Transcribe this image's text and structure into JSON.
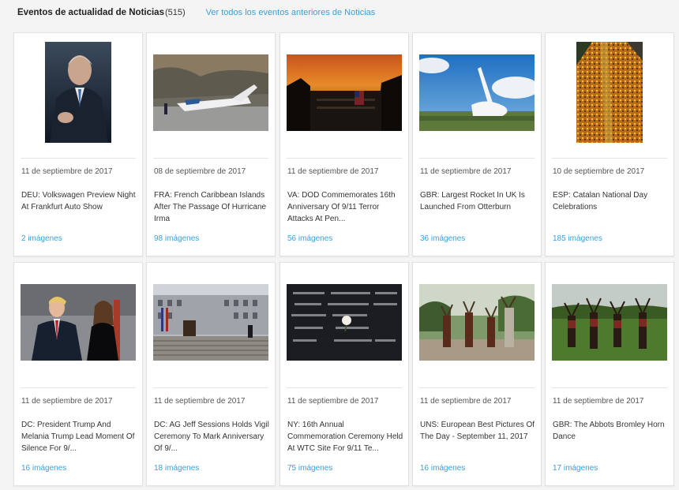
{
  "header": {
    "title": "Eventos de actualidad de Noticias",
    "count": "(515)",
    "link_label": "Ver todos los eventos anteriores de Noticias"
  },
  "colors": {
    "accent": "#3aa0d8",
    "card_bg": "#ffffff",
    "page_bg": "#f4f4f4"
  },
  "cards": [
    {
      "date": "11 de septiembre de 2017",
      "title": "DEU: Volkswagen Preview Night At Frankfurt Auto Show",
      "images": "2 imágenes"
    },
    {
      "date": "08 de septiembre de 2017",
      "title": "FRA: French Caribbean Islands After The Passage Of Hurricane Irma",
      "images": "98 imágenes"
    },
    {
      "date": "11 de septiembre de 2017",
      "title": "VA: DOD Commemorates 16th Anniversary Of 9/11 Terror Attacks At Pen...",
      "images": "56 imágenes"
    },
    {
      "date": "11 de septiembre de 2017",
      "title": "GBR: Largest Rocket In UK Is Launched From Otterburn",
      "images": "36 imágenes"
    },
    {
      "date": "10 de septiembre de 2017",
      "title": "ESP: Catalan National Day Celebrations",
      "images": "185 imágenes"
    },
    {
      "date": "11 de septiembre de 2017",
      "title": "DC: President Trump And Melania Trump Lead Moment Of Silence For 9/...",
      "images": "16 imágenes"
    },
    {
      "date": "11 de septiembre de 2017",
      "title": "DC: AG Jeff Sessions Holds Vigil Ceremony To Mark Anniversary Of 9/...",
      "images": "18 imágenes"
    },
    {
      "date": "11 de septiembre de 2017",
      "title": "NY: 16th Annual Commemoration Ceremony Held At WTC Site For 9/11 Te...",
      "images": "75 imágenes"
    },
    {
      "date": "11 de septiembre de 2017",
      "title": "UNS: European Best Pictures Of The Day - September 11, 2017",
      "images": "16 imágenes"
    },
    {
      "date": "11 de septiembre de 2017",
      "title": "GBR: The Abbots Bromley Horn Dance",
      "images": "17 imágenes"
    }
  ]
}
